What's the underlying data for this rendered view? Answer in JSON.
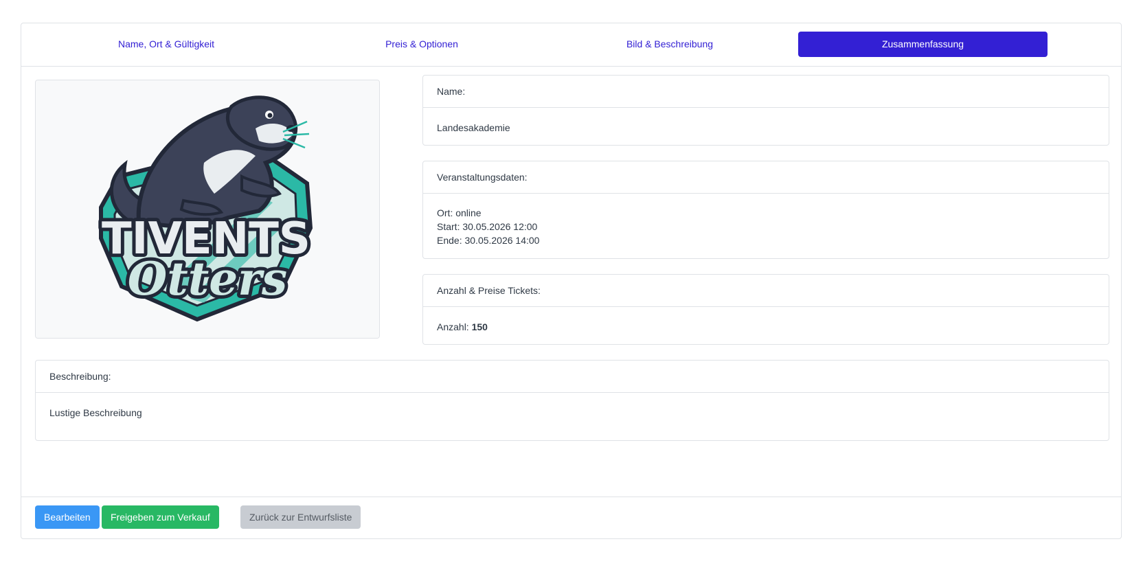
{
  "steps": [
    {
      "label": "Name, Ort & Gültigkeit",
      "active": false
    },
    {
      "label": "Preis & Optionen",
      "active": false
    },
    {
      "label": "Bild & Beschreibung",
      "active": false
    },
    {
      "label": "Zusammenfassung",
      "active": true
    }
  ],
  "image": {
    "logo_line1": "TIVENTS",
    "logo_line2": "Otters",
    "colors": {
      "teal": "#2bb9a6",
      "dark": "#222838",
      "otter": "#3c4258",
      "light": "#e9edf0"
    }
  },
  "name_card": {
    "header": "Name:",
    "value": "Landesakademie"
  },
  "event_card": {
    "header": "Veranstaltungsdaten:",
    "location": "Ort: online",
    "start": "Start: 30.05.2026 12:00",
    "end": "Ende: 30.05.2026 14:00"
  },
  "tickets_card": {
    "header": "Anzahl & Preise Tickets:",
    "count_label": "Anzahl: ",
    "count_value": "150"
  },
  "description_card": {
    "header": "Beschreibung:",
    "text": "Lustige Beschreibung"
  },
  "buttons": {
    "edit": "Bearbeiten",
    "release": "Freigeben zum Verkauf",
    "back": "Zurück zur Entwurfsliste"
  },
  "colors": {
    "primary": "#3320d4",
    "edit_button": "#3a97f5",
    "release_button": "#28b864",
    "back_button": "#c8ccd2"
  }
}
